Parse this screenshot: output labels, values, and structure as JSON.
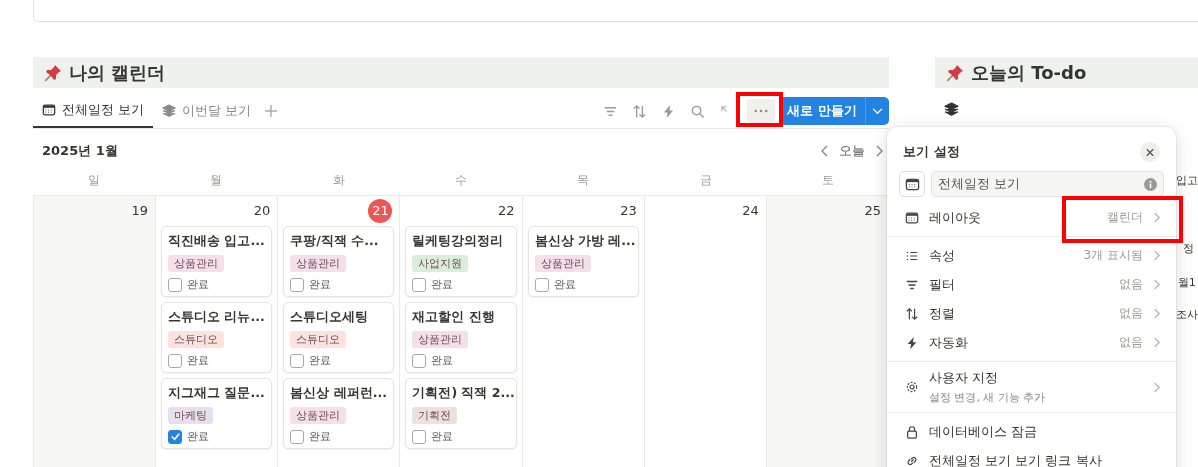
{
  "calendar": {
    "title": "나의 캘린더",
    "tabs": [
      {
        "label": "전체일정 보기",
        "selected": true
      },
      {
        "label": "이번달 보기",
        "selected": false
      }
    ],
    "new_button": "새로 만들기",
    "month": "2025년 1월",
    "today_button": "오늘",
    "weekdays": [
      "일",
      "월",
      "화",
      "수",
      "목",
      "금",
      "토"
    ],
    "days": [
      {
        "date": "19",
        "today": false
      },
      {
        "date": "20",
        "today": false,
        "events": [
          {
            "title": "직진배송 입고...",
            "tag": "상품관리",
            "color": "#f5e0e9",
            "done_label": "완료",
            "checked": false
          },
          {
            "title": "스튜디오 리뉴...",
            "tag": "스튜디오",
            "color": "#ffe2dd",
            "done_label": "완료",
            "checked": false
          },
          {
            "title": "지그재그 질문...",
            "tag": "마케팅",
            "color": "#e8deee",
            "done_label": "완료",
            "checked": true
          }
        ]
      },
      {
        "date": "21",
        "today": true,
        "events": [
          {
            "title": "쿠팡/직잭 수...",
            "tag": "상품관리",
            "color": "#f5e0e9",
            "done_label": "완료",
            "checked": false
          },
          {
            "title": "스튜디오세팅",
            "tag": "스튜디오",
            "color": "#ffe2dd",
            "done_label": "완료",
            "checked": false
          },
          {
            "title": "봄신상 레퍼런...",
            "tag": "상품관리",
            "color": "#f5e0e9",
            "done_label": "완료",
            "checked": false
          }
        ]
      },
      {
        "date": "22",
        "today": false,
        "events": [
          {
            "title": "릴케팅강의정리",
            "tag": "사업지원",
            "color": "#dbeddb",
            "done_label": "완료",
            "checked": false
          },
          {
            "title": "재고할인 진행",
            "tag": "상품관리",
            "color": "#f5e0e9",
            "done_label": "완료",
            "checked": false
          },
          {
            "title": "기획전) 직잭 2...",
            "tag": "기획전",
            "color": "#eee0da",
            "done_label": "완료",
            "checked": false
          }
        ]
      },
      {
        "date": "23",
        "today": false,
        "events": [
          {
            "title": "봄신상 가방 레...",
            "tag": "상품관리",
            "color": "#f5e0e9",
            "done_label": "완료",
            "checked": false
          }
        ]
      },
      {
        "date": "24",
        "today": false
      },
      {
        "date": "25",
        "today": false
      }
    ]
  },
  "todo": {
    "title": "오늘의 To-do",
    "rows": [
      "입고",
      "정",
      "월1",
      "조사"
    ]
  },
  "view_settings": {
    "title": "보기 설정",
    "name_value": "전체일정 보기",
    "groups": [
      [
        {
          "label": "레이아웃",
          "value": "캘린더"
        }
      ],
      [
        {
          "label": "속성",
          "value": "3개 표시됨"
        },
        {
          "label": "필터",
          "value": "없음"
        },
        {
          "label": "정렬",
          "value": "없음"
        },
        {
          "label": "자동화",
          "value": "없음"
        }
      ],
      [
        {
          "label": "사용자 지정",
          "sub": "설정 변경, 새 기능 추가"
        }
      ],
      [
        {
          "label": "데이터베이스 잠금"
        },
        {
          "label": "전체일정 보기 보기 링크 복사"
        }
      ]
    ]
  }
}
